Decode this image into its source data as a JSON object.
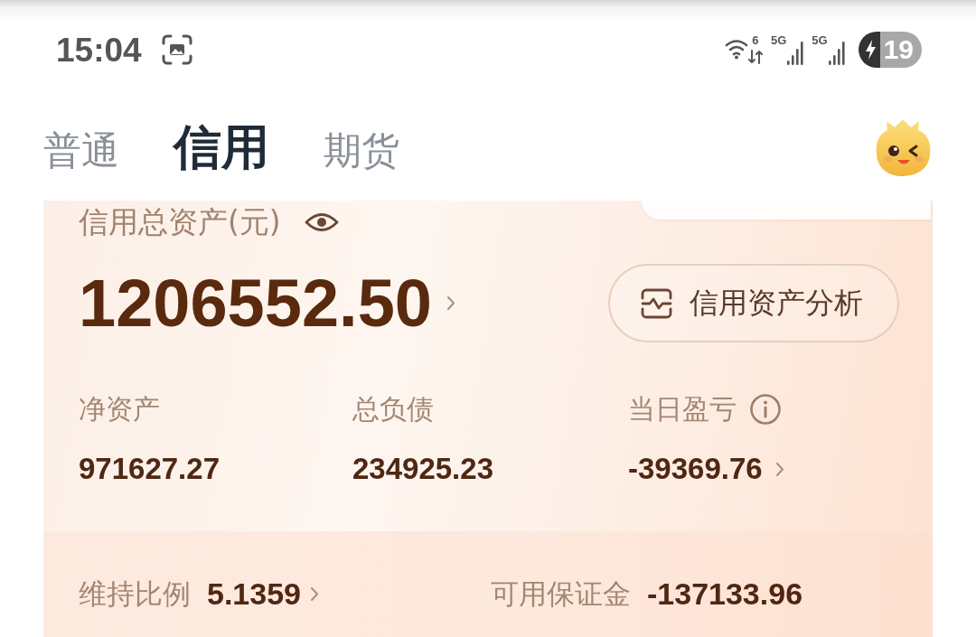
{
  "status_bar": {
    "time": "15:04",
    "wifi": {
      "label": "6"
    },
    "signals": [
      {
        "label": "5G"
      },
      {
        "label": "5G"
      }
    ],
    "battery": {
      "percent": "19",
      "charging": true
    }
  },
  "tabs": [
    {
      "label": "普通",
      "selected": false
    },
    {
      "label": "信用",
      "selected": true
    },
    {
      "label": "期货",
      "selected": false
    }
  ],
  "card": {
    "title": "信用总资产(元)",
    "total": "1206552.50",
    "analysis_button": "信用资产分析",
    "metrics": [
      {
        "label": "净资产",
        "value": "971627.27",
        "info": false,
        "arrow": false
      },
      {
        "label": "总负债",
        "value": "234925.23",
        "info": false,
        "arrow": false
      },
      {
        "label": "当日盈亏",
        "value": "-39369.76",
        "info": true,
        "arrow": true
      }
    ],
    "footer": [
      {
        "label": "维持比例",
        "value": "5.1359",
        "arrow": true
      },
      {
        "label": "可用保证金",
        "value": "-137133.96",
        "arrow": false
      }
    ]
  }
}
